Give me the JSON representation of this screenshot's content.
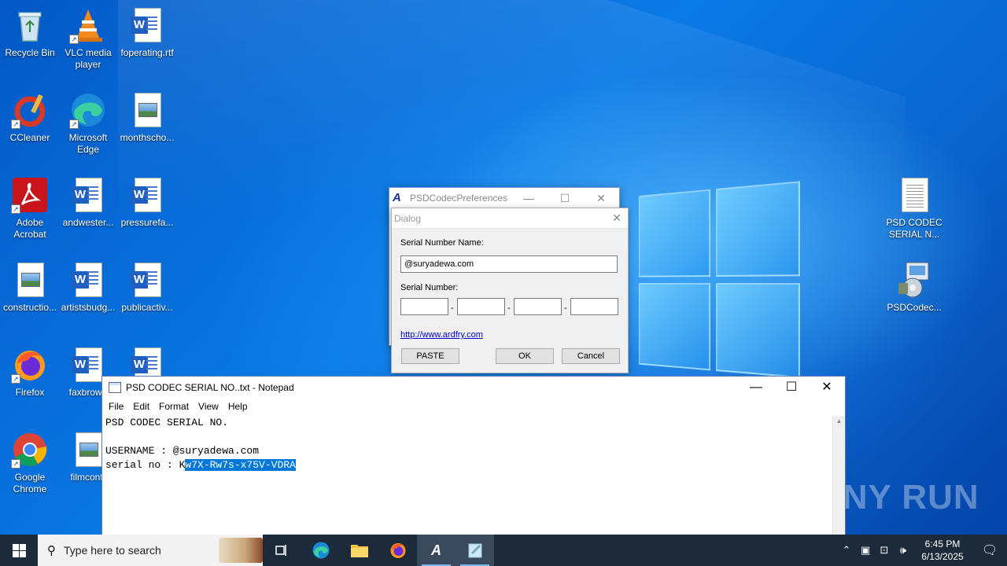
{
  "desktop": {
    "icons": [
      {
        "label": "Recycle Bin"
      },
      {
        "label": "VLC media player"
      },
      {
        "label": "foperating.rtf"
      },
      {
        "label": "CCleaner"
      },
      {
        "label": "Microsoft Edge"
      },
      {
        "label": "monthscho..."
      },
      {
        "label": "Adobe Acrobat"
      },
      {
        "label": "andwester..."
      },
      {
        "label": "pressurefa..."
      },
      {
        "label": "constructio..."
      },
      {
        "label": "artistsbudg..."
      },
      {
        "label": "publicactiv..."
      },
      {
        "label": "Firefox"
      },
      {
        "label": "faxbrown"
      },
      {
        "label": "Google Chrome"
      },
      {
        "label": "filmcontr"
      },
      {
        "label": "PSD CODEC SERIAL N..."
      },
      {
        "label": "PSDCodec..."
      }
    ]
  },
  "psd_window": {
    "title": "PSDCodecPreferences"
  },
  "dialog": {
    "title": "Dialog",
    "serial_name_label": "Serial Number Name:",
    "serial_name_value": "@suryadewa.com",
    "serial_number_label": "Serial Number:",
    "serial_parts": [
      "",
      "",
      "",
      ""
    ],
    "link": "http://www.ardfry.com",
    "paste_label": "PASTE",
    "ok_label": "OK",
    "cancel_label": "Cancel"
  },
  "notepad": {
    "title": "PSD CODEC SERIAL NO..txt - Notepad",
    "menu": [
      "File",
      "Edit",
      "Format",
      "View",
      "Help"
    ],
    "line1": "PSD CODEC SERIAL NO.",
    "line2": "",
    "line3": "USERNAME : @suryadewa.com",
    "line4_prefix": "serial no : K",
    "line4_selected": "w7X-Rw7s-x75V-VDRA"
  },
  "watermark": "ANY RUN",
  "taskbar": {
    "search_placeholder": "Type here to search",
    "time": "6:45 PM",
    "date": "6/13/2025"
  }
}
